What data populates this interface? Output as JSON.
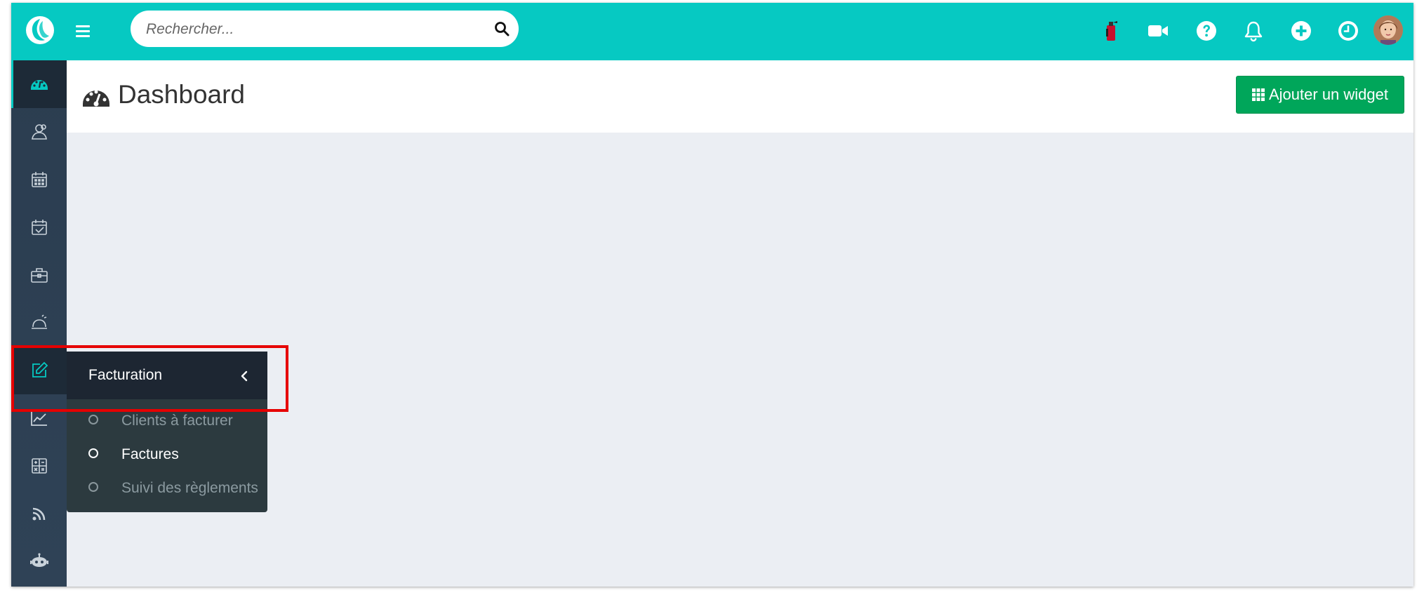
{
  "topbar": {
    "search_placeholder": "Rechercher...",
    "accent_color": "#06c9c2",
    "icons": [
      "extinguisher-icon",
      "video-camera-icon",
      "help-circle-icon",
      "bell-icon",
      "plus-circle-icon",
      "clock-icon"
    ]
  },
  "sidebar": {
    "background": "#2f4256",
    "items": [
      {
        "name": "dashboard",
        "icon": "dashboard-icon"
      },
      {
        "name": "contacts",
        "icon": "users-icon"
      },
      {
        "name": "calendar",
        "icon": "calendar-icon"
      },
      {
        "name": "tasks",
        "icon": "calendar-check-icon"
      },
      {
        "name": "business",
        "icon": "briefcase-icon"
      },
      {
        "name": "service",
        "icon": "service-bell-icon"
      },
      {
        "name": "billing",
        "icon": "edit-icon"
      },
      {
        "name": "statistics",
        "icon": "line-chart-icon"
      },
      {
        "name": "accounting",
        "icon": "calculator-icon"
      },
      {
        "name": "feed",
        "icon": "rss-icon"
      },
      {
        "name": "robot",
        "icon": "robot-icon"
      }
    ]
  },
  "page": {
    "title": "Dashboard",
    "add_widget_label": "Ajouter un widget",
    "button_color": "#00a65a"
  },
  "flyout": {
    "title": "Facturation",
    "items": [
      {
        "label": "Clients à facturer",
        "active": false
      },
      {
        "label": "Factures",
        "active": true
      },
      {
        "label": "Suivi des règlements",
        "active": false
      }
    ]
  },
  "annotation": {
    "color": "#e60000"
  }
}
